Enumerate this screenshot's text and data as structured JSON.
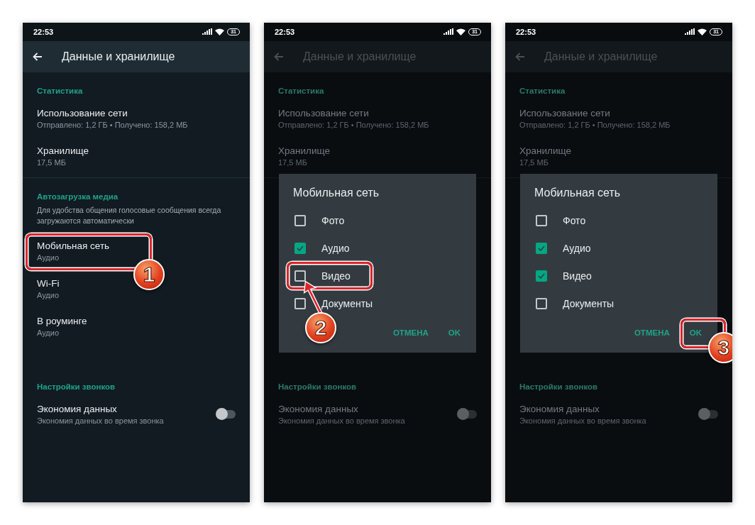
{
  "screens": [
    {
      "status_bar": {
        "time": "22:53",
        "battery": "31"
      },
      "app_bar": {
        "title": "Данные и хранилище"
      },
      "dimmed": false,
      "top_sections": [
        {
          "header": "Статистика",
          "rows": [
            {
              "title": "Использование сети",
              "subtitle": "Отправлено: 1,2 ГБ • Получено: 158,2 МБ"
            },
            {
              "title": "Хранилище",
              "subtitle": "17,5 МБ"
            }
          ]
        }
      ],
      "middle_sections": [
        {
          "header": "Автозагрузка медиа",
          "description": "Для удобства общения голосовые сообщения всегда загружаются автоматически",
          "rows": [
            {
              "title": "Мобильная сеть",
              "subtitle": "Аудио",
              "callout": "1"
            },
            {
              "title": "Wi-Fi",
              "subtitle": "Аудио"
            },
            {
              "title": "В роуминге",
              "subtitle": "Аудио"
            }
          ]
        }
      ],
      "bottom_sections": [
        {
          "header": "Настройки звонков",
          "rows": [
            {
              "title": "Экономия данных",
              "subtitle": "Экономия данных во время звонка",
              "toggle": {
                "on": false
              }
            }
          ]
        }
      ]
    },
    {
      "status_bar": {
        "time": "22:53",
        "battery": "31"
      },
      "app_bar": {
        "title": "Данные и хранилище"
      },
      "dimmed": true,
      "top_sections": [
        {
          "header": "Статистика",
          "rows": [
            {
              "title": "Использование сети",
              "subtitle": "Отправлено: 1,2 ГБ • Получено: 158,2 МБ"
            },
            {
              "title": "Хранилище",
              "subtitle": "17,5 МБ"
            }
          ]
        }
      ],
      "dialog": {
        "title": "Мобильная сеть",
        "options": [
          {
            "label": "Фото",
            "checked": false
          },
          {
            "label": "Аудио",
            "checked": true
          },
          {
            "label": "Видео",
            "checked": false,
            "callout": "2",
            "arrow": true
          },
          {
            "label": "Документы",
            "checked": false
          }
        ],
        "buttons": [
          {
            "label": "ОТМЕНА"
          },
          {
            "label": "OK"
          }
        ]
      },
      "bottom_sections": [
        {
          "header": "Настройки звонков",
          "rows": [
            {
              "title": "Экономия данных",
              "subtitle": "Экономия данных во время звонка",
              "toggle": {
                "on": false
              }
            }
          ]
        }
      ]
    },
    {
      "status_bar": {
        "time": "22:53",
        "battery": "31"
      },
      "app_bar": {
        "title": "Данные и хранилище"
      },
      "dimmed": true,
      "top_sections": [
        {
          "header": "Статистика",
          "rows": [
            {
              "title": "Использование сети",
              "subtitle": "Отправлено: 1,2 ГБ • Получено: 158,2 МБ"
            },
            {
              "title": "Хранилище",
              "subtitle": "17,5 МБ"
            }
          ]
        }
      ],
      "dialog": {
        "title": "Мобильная сеть",
        "options": [
          {
            "label": "Фото",
            "checked": false
          },
          {
            "label": "Аудио",
            "checked": true
          },
          {
            "label": "Видео",
            "checked": true
          },
          {
            "label": "Документы",
            "checked": false
          }
        ],
        "buttons": [
          {
            "label": "ОТМЕНА"
          },
          {
            "label": "OK",
            "callout": "3"
          }
        ]
      },
      "bottom_sections": [
        {
          "header": "Настройки звонков",
          "rows": [
            {
              "title": "Экономия данных",
              "subtitle": "Экономия данных во время звонка",
              "toggle": {
                "on": false
              }
            }
          ]
        }
      ]
    }
  ]
}
